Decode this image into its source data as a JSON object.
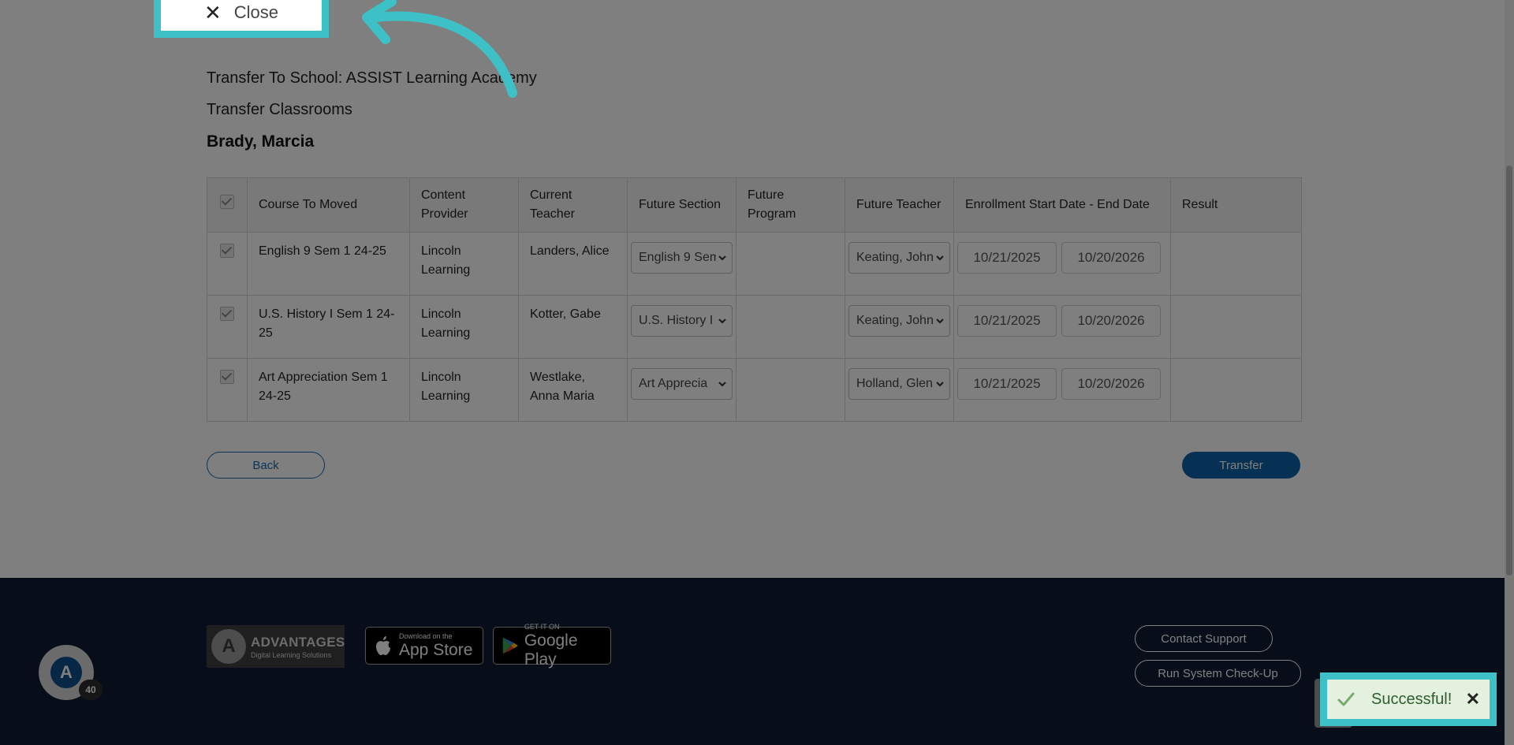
{
  "page": {
    "transfer_to_school": "Transfer To School: ASSIST Learning Academy",
    "transfer_classrooms": "Transfer Classrooms",
    "student_name": "Brady, Marcia"
  },
  "table": {
    "headers": [
      "Course To Moved",
      "Content Provider",
      "Current Teacher",
      "Future Section",
      "Future Program",
      "Future Teacher",
      "Enrollment Start Date - End Date",
      "Result"
    ],
    "rows": [
      {
        "checked": true,
        "course": "English 9 Sem 1 24-25",
        "provider": "Lincoln Learning",
        "teacher": "Landers, Alice",
        "future_section": "English 9 Sem",
        "future_program": "",
        "future_teacher": "Keating, John",
        "start": "10/21/2025",
        "end": "10/20/2026",
        "result": ""
      },
      {
        "checked": true,
        "course": "U.S. History I Sem 1 24-25",
        "provider": "Lincoln Learning",
        "teacher": "Kotter, Gabe",
        "future_section": "U.S. History I",
        "future_program": "",
        "future_teacher": "Keating, John",
        "start": "10/21/2025",
        "end": "10/20/2026",
        "result": ""
      },
      {
        "checked": true,
        "course": "Art Appreciation Sem 1 24-25",
        "provider": "Lincoln Learning",
        "teacher": "Westlake, Anna Maria",
        "future_section": "Art Apprecia",
        "future_program": "",
        "future_teacher": "Holland, Glen",
        "start": "10/21/2025",
        "end": "10/20/2026",
        "result": ""
      }
    ]
  },
  "buttons": {
    "back": "Back",
    "transfer": "Transfer"
  },
  "footer": {
    "logo_brand": "ADVANTAGES",
    "logo_tagline": "Digital Learning Solutions",
    "app_store_small": "Download on the",
    "app_store_big": "App Store",
    "google_play_small": "GET IT ON",
    "google_play_big": "Google Play",
    "contact_support": "Contact Support",
    "run_system_checkup": "Run System Check-Up"
  },
  "chat": {
    "badge_count": "40",
    "avatar_letter": "A"
  },
  "callout": {
    "close_label": "Close",
    "close_icon": "close-icon"
  },
  "toast": {
    "message": "Successful!",
    "icon": "check-icon"
  },
  "colors": {
    "accent": "#3ec0c7",
    "primary": "#0c62a8",
    "footer_bg": "#0e1b33",
    "toast_bg": "#e4f1df"
  }
}
